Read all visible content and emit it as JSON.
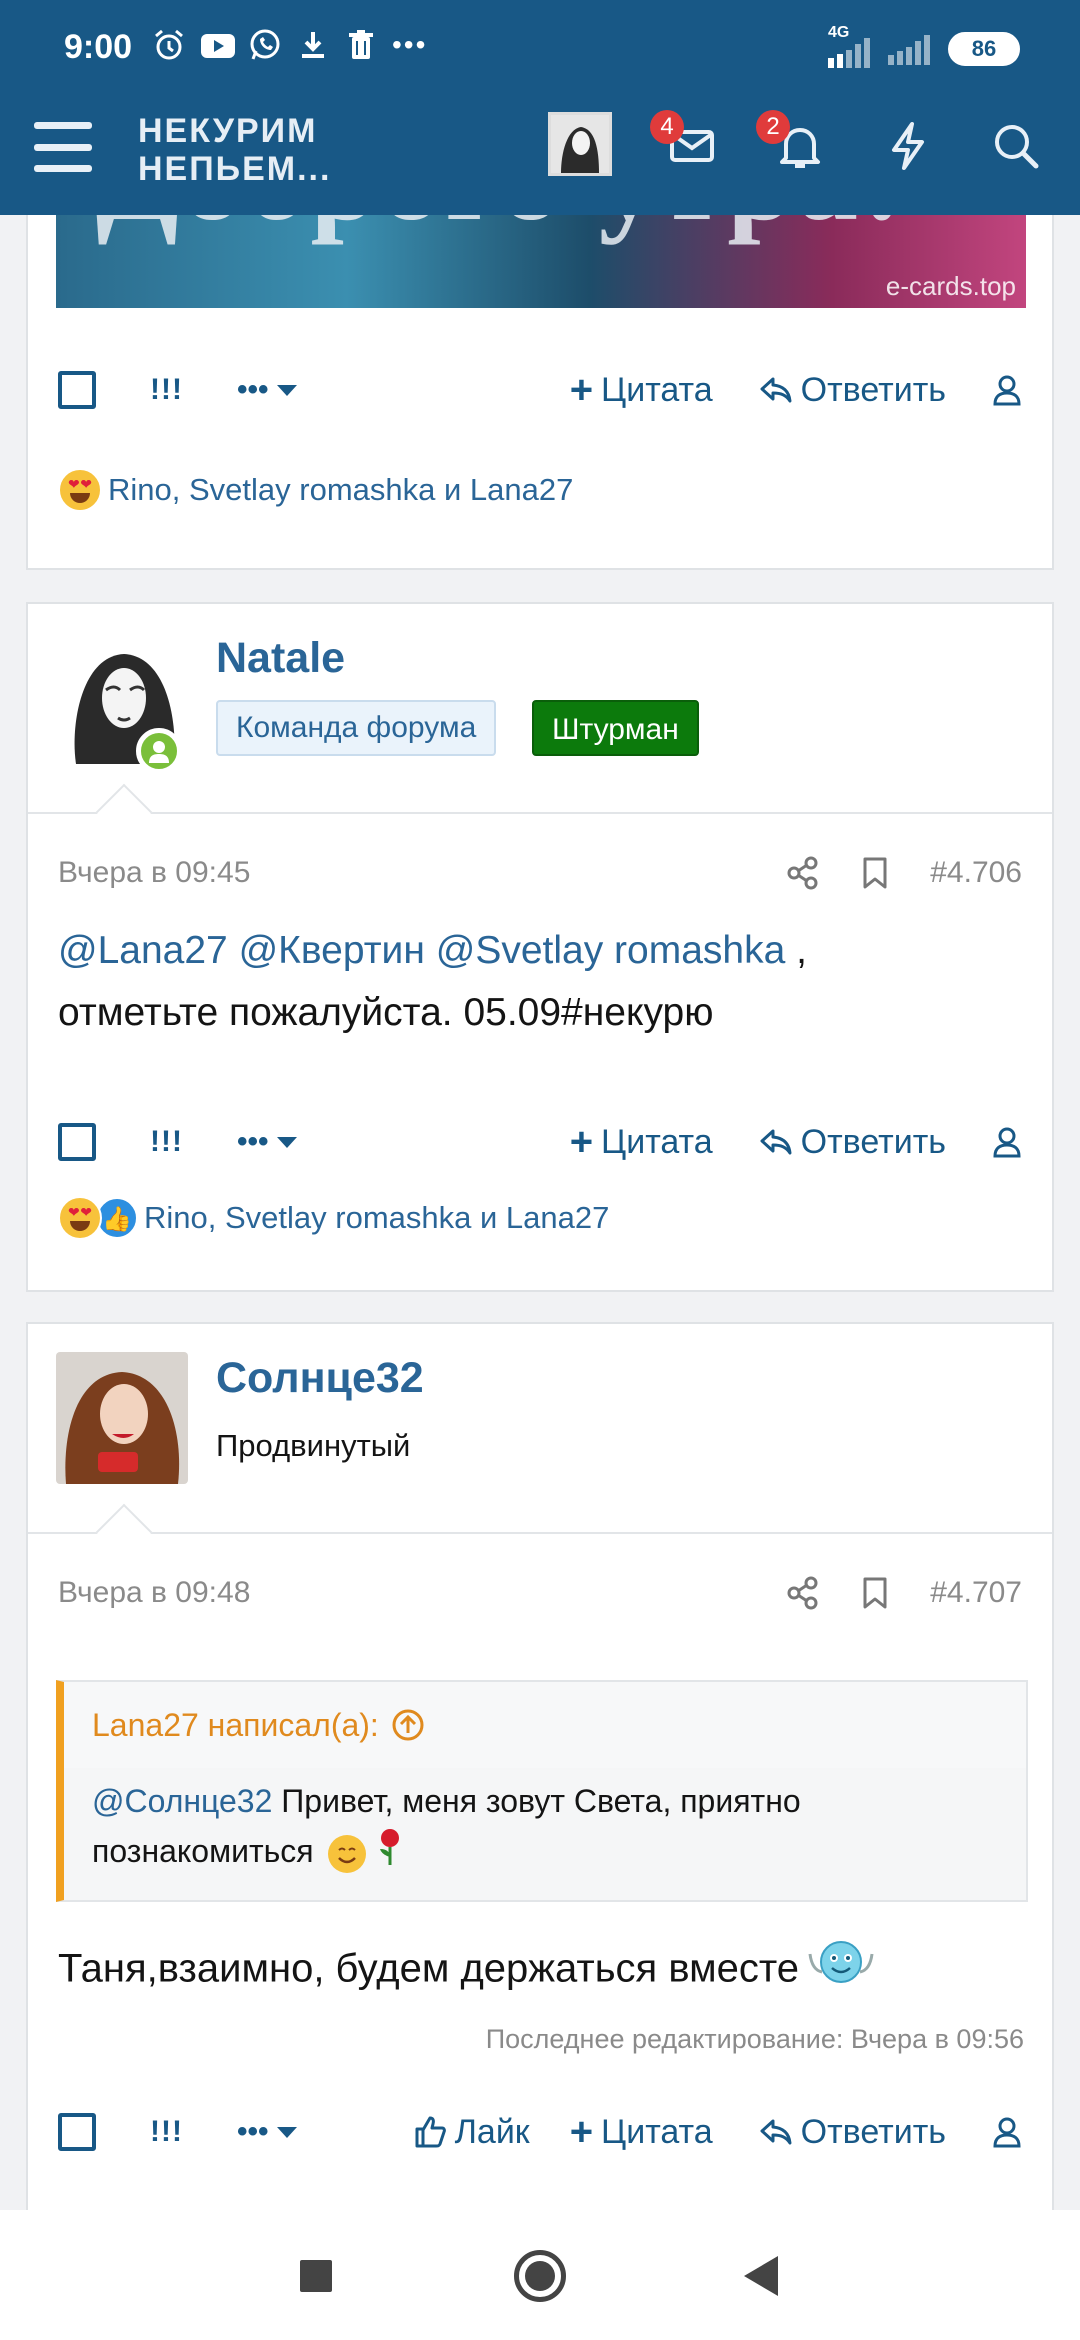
{
  "status_bar": {
    "time": "9:00",
    "icons": [
      "alarm-icon",
      "youtube-icon",
      "whatsapp-icon",
      "download-icon",
      "trash-icon",
      "more-dots-icon"
    ],
    "network": "4G",
    "battery": "86"
  },
  "header": {
    "logo_line1": "НЕКУРИМ",
    "logo_line2": "НЕПЬЕМ...",
    "messages_badge": "4",
    "notifications_badge": "2"
  },
  "actions": {
    "marks": "!!!",
    "like": "Лайк",
    "quote": "Цитата",
    "reply": "Ответить"
  },
  "image_caption": "e-cards.top",
  "post1": {
    "reactions_text": "Rino, Svetlay romashka и Lana27"
  },
  "post2": {
    "username": "Natale",
    "badge1": "Команда форума",
    "badge2": "Штурман",
    "time": "Вчера в 09:45",
    "number": "#4.706",
    "mention1": "@Lana27",
    "mention2": "@Квертин",
    "mention3": "@Svetlay romashka",
    "after_mentions": " ,",
    "text": "отметьте пожалуйста. 05.09#некурю",
    "reactions_text": "Rino, Svetlay romashka и Lana27"
  },
  "post3": {
    "username": "Солнце32",
    "title": "Продвинутый",
    "time": "Вчера в 09:48",
    "number": "#4.707",
    "quote_author": "Lana27 написал(а):",
    "quote_mention": "@Солнце32",
    "quote_text": " Привет, меня зовут Света, приятно познакомиться",
    "body": "Таня,взаимно, будем держаться вместе",
    "edited": "Последнее редактирование: Вчера в 09:56"
  },
  "colors": {
    "header_bg": "#185886",
    "link": "#2a6597",
    "staff_badge_bg": "#eaf3fb",
    "navigator_badge_bg": "#0c7a0c",
    "quote_border": "#f0a020",
    "quote_author": "#e08a1e"
  }
}
